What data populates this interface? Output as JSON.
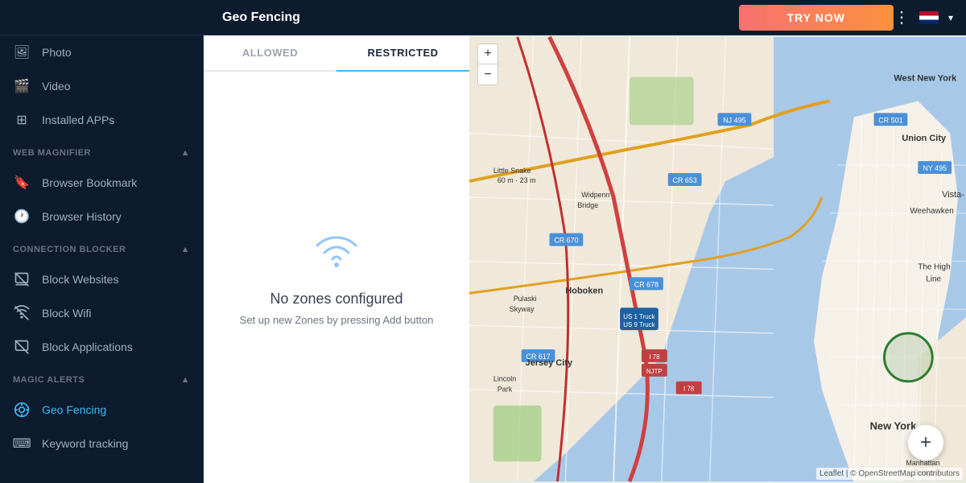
{
  "header": {
    "title": "Geo Fencing",
    "try_now_label": "TRY NOW",
    "dots": "⋮"
  },
  "sidebar": {
    "items_top": [
      {
        "id": "photo",
        "label": "Photo",
        "icon": "🖼"
      },
      {
        "id": "video",
        "label": "Video",
        "icon": "🎬"
      },
      {
        "id": "installed-apps",
        "label": "Installed APPs",
        "icon": "⊞"
      }
    ],
    "section_web_magnifier": "WEB MAGNIFIER",
    "items_web": [
      {
        "id": "browser-bookmark",
        "label": "Browser Bookmark",
        "icon": "🔖"
      },
      {
        "id": "browser-history",
        "label": "Browser History",
        "icon": "🕐"
      }
    ],
    "section_connection_blocker": "CONNECTION BLOCKER",
    "items_connection": [
      {
        "id": "block-websites",
        "label": "Block Websites",
        "icon": "⊘"
      },
      {
        "id": "block-wifi",
        "label": "Block Wifi",
        "icon": "📶"
      },
      {
        "id": "block-applications",
        "label": "Block Applications",
        "icon": "🚫"
      }
    ],
    "section_magic_alerts": "MAGIC ALERTS",
    "items_magic": [
      {
        "id": "geo-fencing",
        "label": "Geo Fencing",
        "icon": "🎯",
        "active": true
      },
      {
        "id": "keyword-tracking",
        "label": "Keyword tracking",
        "icon": "⌨"
      }
    ]
  },
  "tabs": [
    {
      "id": "allowed",
      "label": "ALLOWED"
    },
    {
      "id": "restricted",
      "label": "RESTRICTED",
      "active": true
    }
  ],
  "empty_state": {
    "title": "No zones configured",
    "subtitle": "Set up new Zones by pressing Add button"
  },
  "add_button_label": "+",
  "map": {
    "zoom_plus": "+",
    "zoom_minus": "−",
    "attribution": "Leaflet | © OpenStreetMap contributors"
  }
}
